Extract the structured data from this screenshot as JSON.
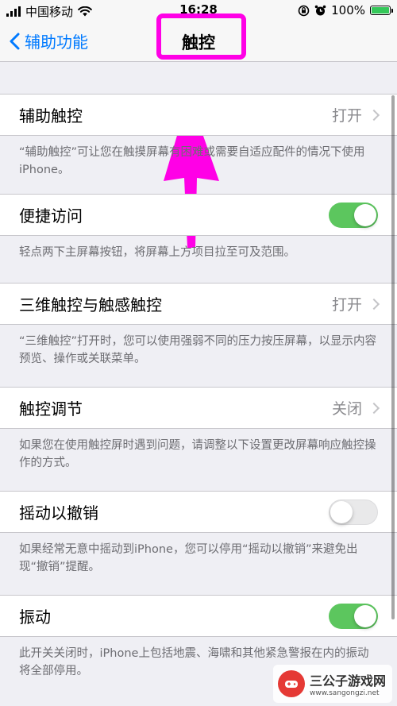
{
  "status_bar": {
    "carrier": "中国移动",
    "time": "16:28",
    "battery_percent": "100%",
    "battery_level": 1.0
  },
  "nav": {
    "back_label": "辅助功能",
    "title": "触控"
  },
  "sections": [
    {
      "label": "辅助触控",
      "value": "打开",
      "control": "chevron",
      "footer": "“辅助触控”可让您在触摸屏幕有困难或需要自适应配件的情况下使用 iPhone。"
    },
    {
      "label": "便捷访问",
      "control": "toggle",
      "toggle_on": true,
      "footer": "轻点两下主屏幕按钮，将屏幕上方项目拉至可及范围。"
    },
    {
      "label": "三维触控与触感触控",
      "value": "打开",
      "control": "chevron",
      "footer": "“三维触控”打开时，您可以使用强弱不同的压力按压屏幕，以显示内容预览、操作或关联菜单。"
    },
    {
      "label": "触控调节",
      "value": "关闭",
      "control": "chevron",
      "footer": "如果您在使用触控屏时遇到问题，请调整以下设置更改屏幕响应触控操作的方式。"
    },
    {
      "label": "摇动以撤销",
      "control": "toggle",
      "toggle_on": false,
      "footer": "如果经常无意中摇动到iPhone，您可以停用“摇动以撤销”来避免出现“撤销”提醒。"
    },
    {
      "label": "振动",
      "control": "toggle",
      "toggle_on": true,
      "footer": "此开关关闭时，iPhone上包括地震、海啸和其他紧急警报在内的振动将全部停用。"
    }
  ],
  "colors": {
    "accent": "#007aff",
    "toggle_on": "#5cc65e",
    "annotation": "#ff00e6",
    "background": "#efeff4"
  },
  "icons": {
    "back": "chevron-left-icon",
    "wifi": "wifi-icon",
    "lock": "orientation-lock-icon",
    "alarm": "alarm-icon",
    "battery": "battery-charging-icon"
  },
  "watermark": {
    "title": "三公子游戏网",
    "url": "www.sangongzi.net"
  }
}
